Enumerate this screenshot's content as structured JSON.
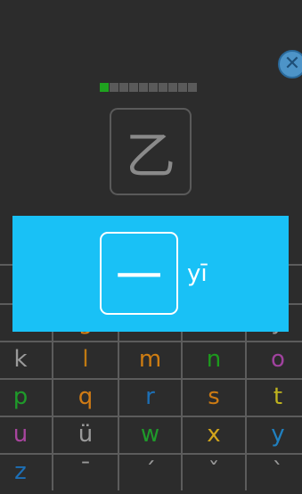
{
  "quiz": {
    "current_character": "乙",
    "progress_done": 1,
    "progress_total": 10
  },
  "answer_popup": {
    "character": "一",
    "pinyin": "yī",
    "background": "#19c1f6"
  },
  "keyboard": {
    "rows": [
      [
        {
          "label": "",
          "color": "#9a9a9a"
        },
        {
          "label": "g",
          "color": "#d98014"
        },
        {
          "label": "",
          "color": "#9a9a9a"
        },
        {
          "label": "",
          "color": "#9a9a9a"
        },
        {
          "label": "y",
          "color": "#9a9a9a"
        }
      ],
      [
        {
          "label": "k",
          "color": "#9a9a9a"
        },
        {
          "label": "l",
          "color": "#c07a12"
        },
        {
          "label": "m",
          "color": "#cf7d12"
        },
        {
          "label": "n",
          "color": "#1d9a1d"
        },
        {
          "label": "o",
          "color": "#a0429e"
        }
      ],
      [
        {
          "label": "p",
          "color": "#1f9a2a"
        },
        {
          "label": "q",
          "color": "#d07b15"
        },
        {
          "label": "r",
          "color": "#1d6fb5"
        },
        {
          "label": "s",
          "color": "#cd7b13"
        },
        {
          "label": "t",
          "color": "#bfb31e"
        }
      ],
      [
        {
          "label": "u",
          "color": "#a8459e"
        },
        {
          "label": "ü",
          "color": "#9a9a9a"
        },
        {
          "label": "w",
          "color": "#1f9a2a"
        },
        {
          "label": "x",
          "color": "#d2a61c"
        },
        {
          "label": "y",
          "color": "#2080c0"
        }
      ],
      [
        {
          "label": "z",
          "color": "#1d6fb5"
        },
        {
          "label": "ˉ",
          "color": "#9a9a9a"
        },
        {
          "label": "ˊ",
          "color": "#9a9a9a"
        },
        {
          "label": "ˇ",
          "color": "#9a9a9a"
        },
        {
          "label": "ˋ",
          "color": "#9a9a9a"
        }
      ]
    ]
  },
  "icons": {
    "close": "close-icon"
  },
  "colors": {
    "accent_popup": "#19c1f6",
    "close_button": "#4d94c8",
    "progress_done": "#1fa21f"
  }
}
